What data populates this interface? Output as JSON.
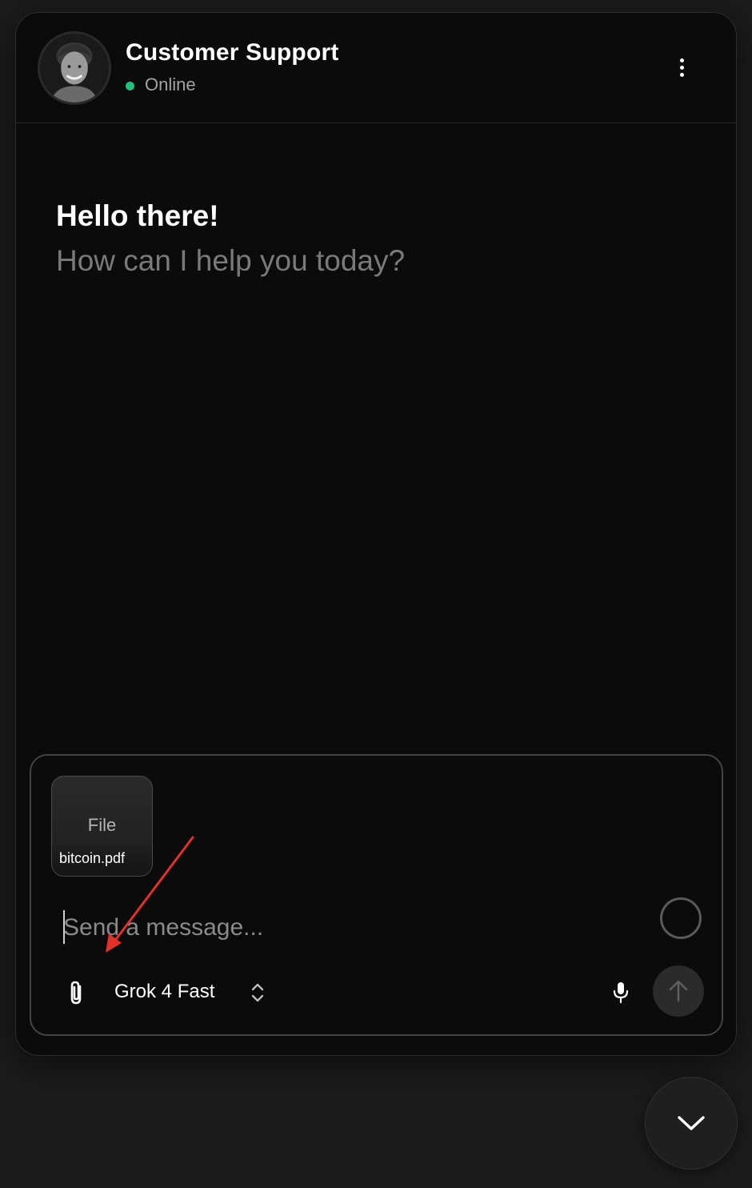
{
  "header": {
    "title": "Customer Support",
    "status": "Online",
    "status_color": "#22c07a",
    "avatar_icon": "user-photo-avatar",
    "menu_icon": "vertical-ellipsis-icon"
  },
  "greeting": {
    "title": "Hello there!",
    "subtitle": "How can I help you today?"
  },
  "composer": {
    "attachment": {
      "type_label": "File",
      "file_name": "bitcoin.pdf"
    },
    "input": {
      "placeholder": "Send a message...",
      "value": ""
    },
    "model": {
      "selected": "Grok 4 Fast"
    },
    "icons": {
      "attach": "paperclip-icon",
      "model_chevron": "chevron-up-down-icon",
      "mic": "microphone-icon",
      "send": "arrow-up-icon",
      "status": "loading-circle-icon"
    }
  },
  "scroll_button": {
    "icon": "chevron-down-icon"
  },
  "annotation": {
    "color": "#e0322b"
  }
}
